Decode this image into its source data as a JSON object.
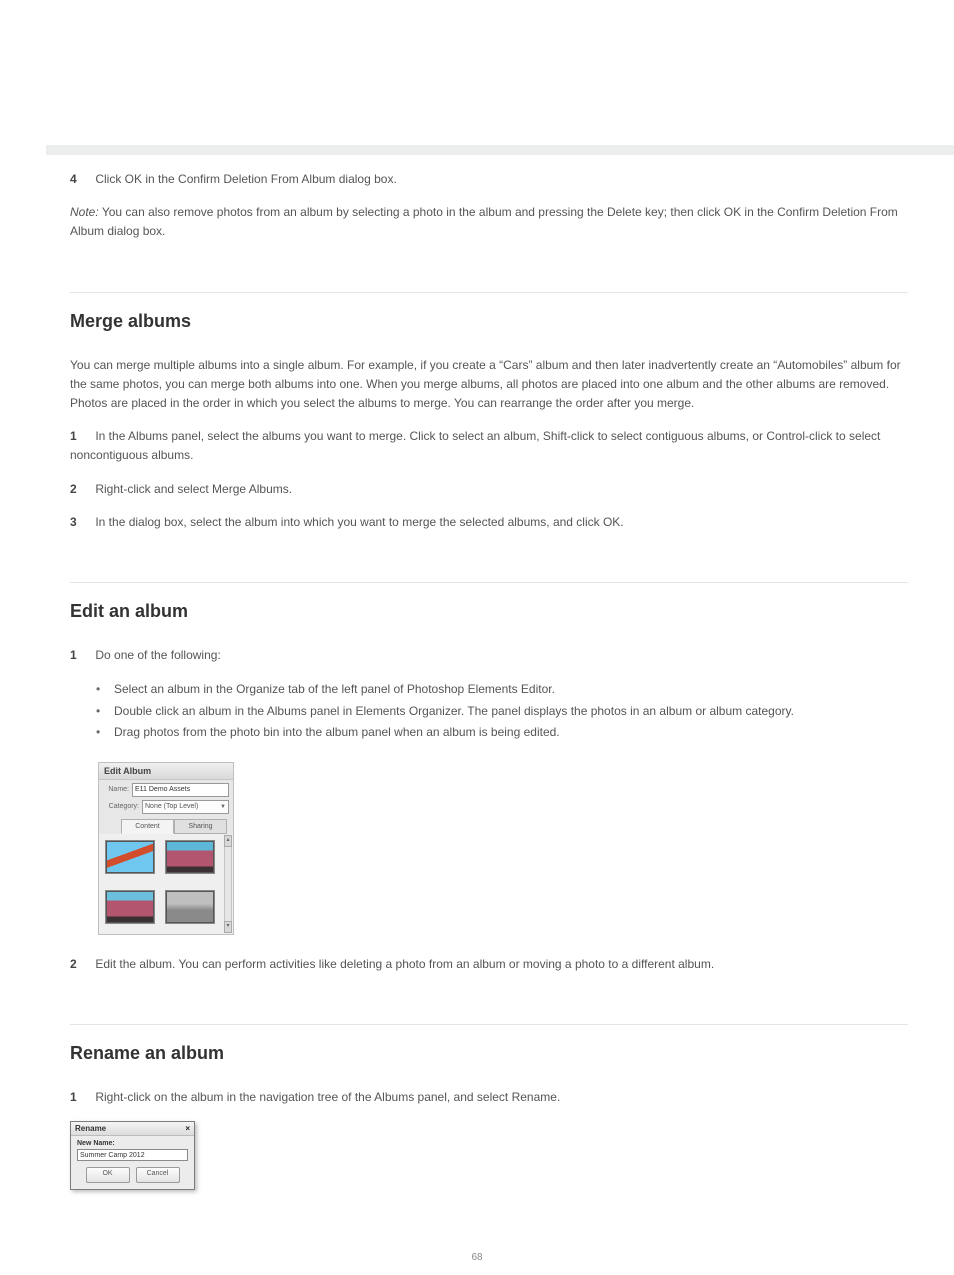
{
  "page_number": "68",
  "intro_steps": {
    "step4": "Click OK in the Confirm Deletion From Album dialog box.",
    "note_label": "Note:",
    "note_text": "You can also remove photos from an album by selecting a photo in the album and pressing the Delete key; then click OK in the Confirm Deletion From Album dialog box."
  },
  "section1": {
    "title": "Merge albums",
    "p1": "You can merge multiple albums into a single album. For example, if you create a “Cars” album and then later inadvertently create an “Automobiles” album for the same photos, you can merge both albums into one. When you merge albums, all photos are placed into one album and the other albums are removed. Photos are placed in the order in which you select the albums to merge. You can rearrange the order after you merge.",
    "step1": "In the Albums panel, select the albums you want to merge. Click to select an album, Shift-click to select contiguous albums, or Control-click to select noncontiguous albums.",
    "step2": "Right-click and select Merge Albums.",
    "step3": "In the dialog box, select the album into which you want to merge the selected albums, and click OK."
  },
  "section2": {
    "title": "Edit an album",
    "step1_intro": "Do one of the following:",
    "bullets": [
      "Select an album in the Organize tab of the left panel of Photoshop Elements Editor.",
      "Double click an album in the Albums panel in Elements Organizer. The panel displays the photos in an album or album category.",
      "Drag photos from the photo bin into the album panel when an album is being edited."
    ],
    "step2": "Edit the album. You can perform activities like deleting a photo from an album or moving a photo to a different album."
  },
  "edit_album_panel": {
    "title": "Edit Album",
    "name_label": "Name:",
    "name_value": "E11 Demo Assets",
    "category_label": "Category:",
    "category_value": "None (Top Level)",
    "tabs": {
      "content": "Content",
      "sharing": "Sharing"
    }
  },
  "section3": {
    "title": "Rename an album",
    "step1": "Right-click on the album in the navigation tree of the Albums panel, and select Rename."
  },
  "rename_dialog": {
    "title": "Rename",
    "label": "New Name:",
    "value": "Summer Camp 2012",
    "ok": "OK",
    "cancel": "Cancel"
  }
}
